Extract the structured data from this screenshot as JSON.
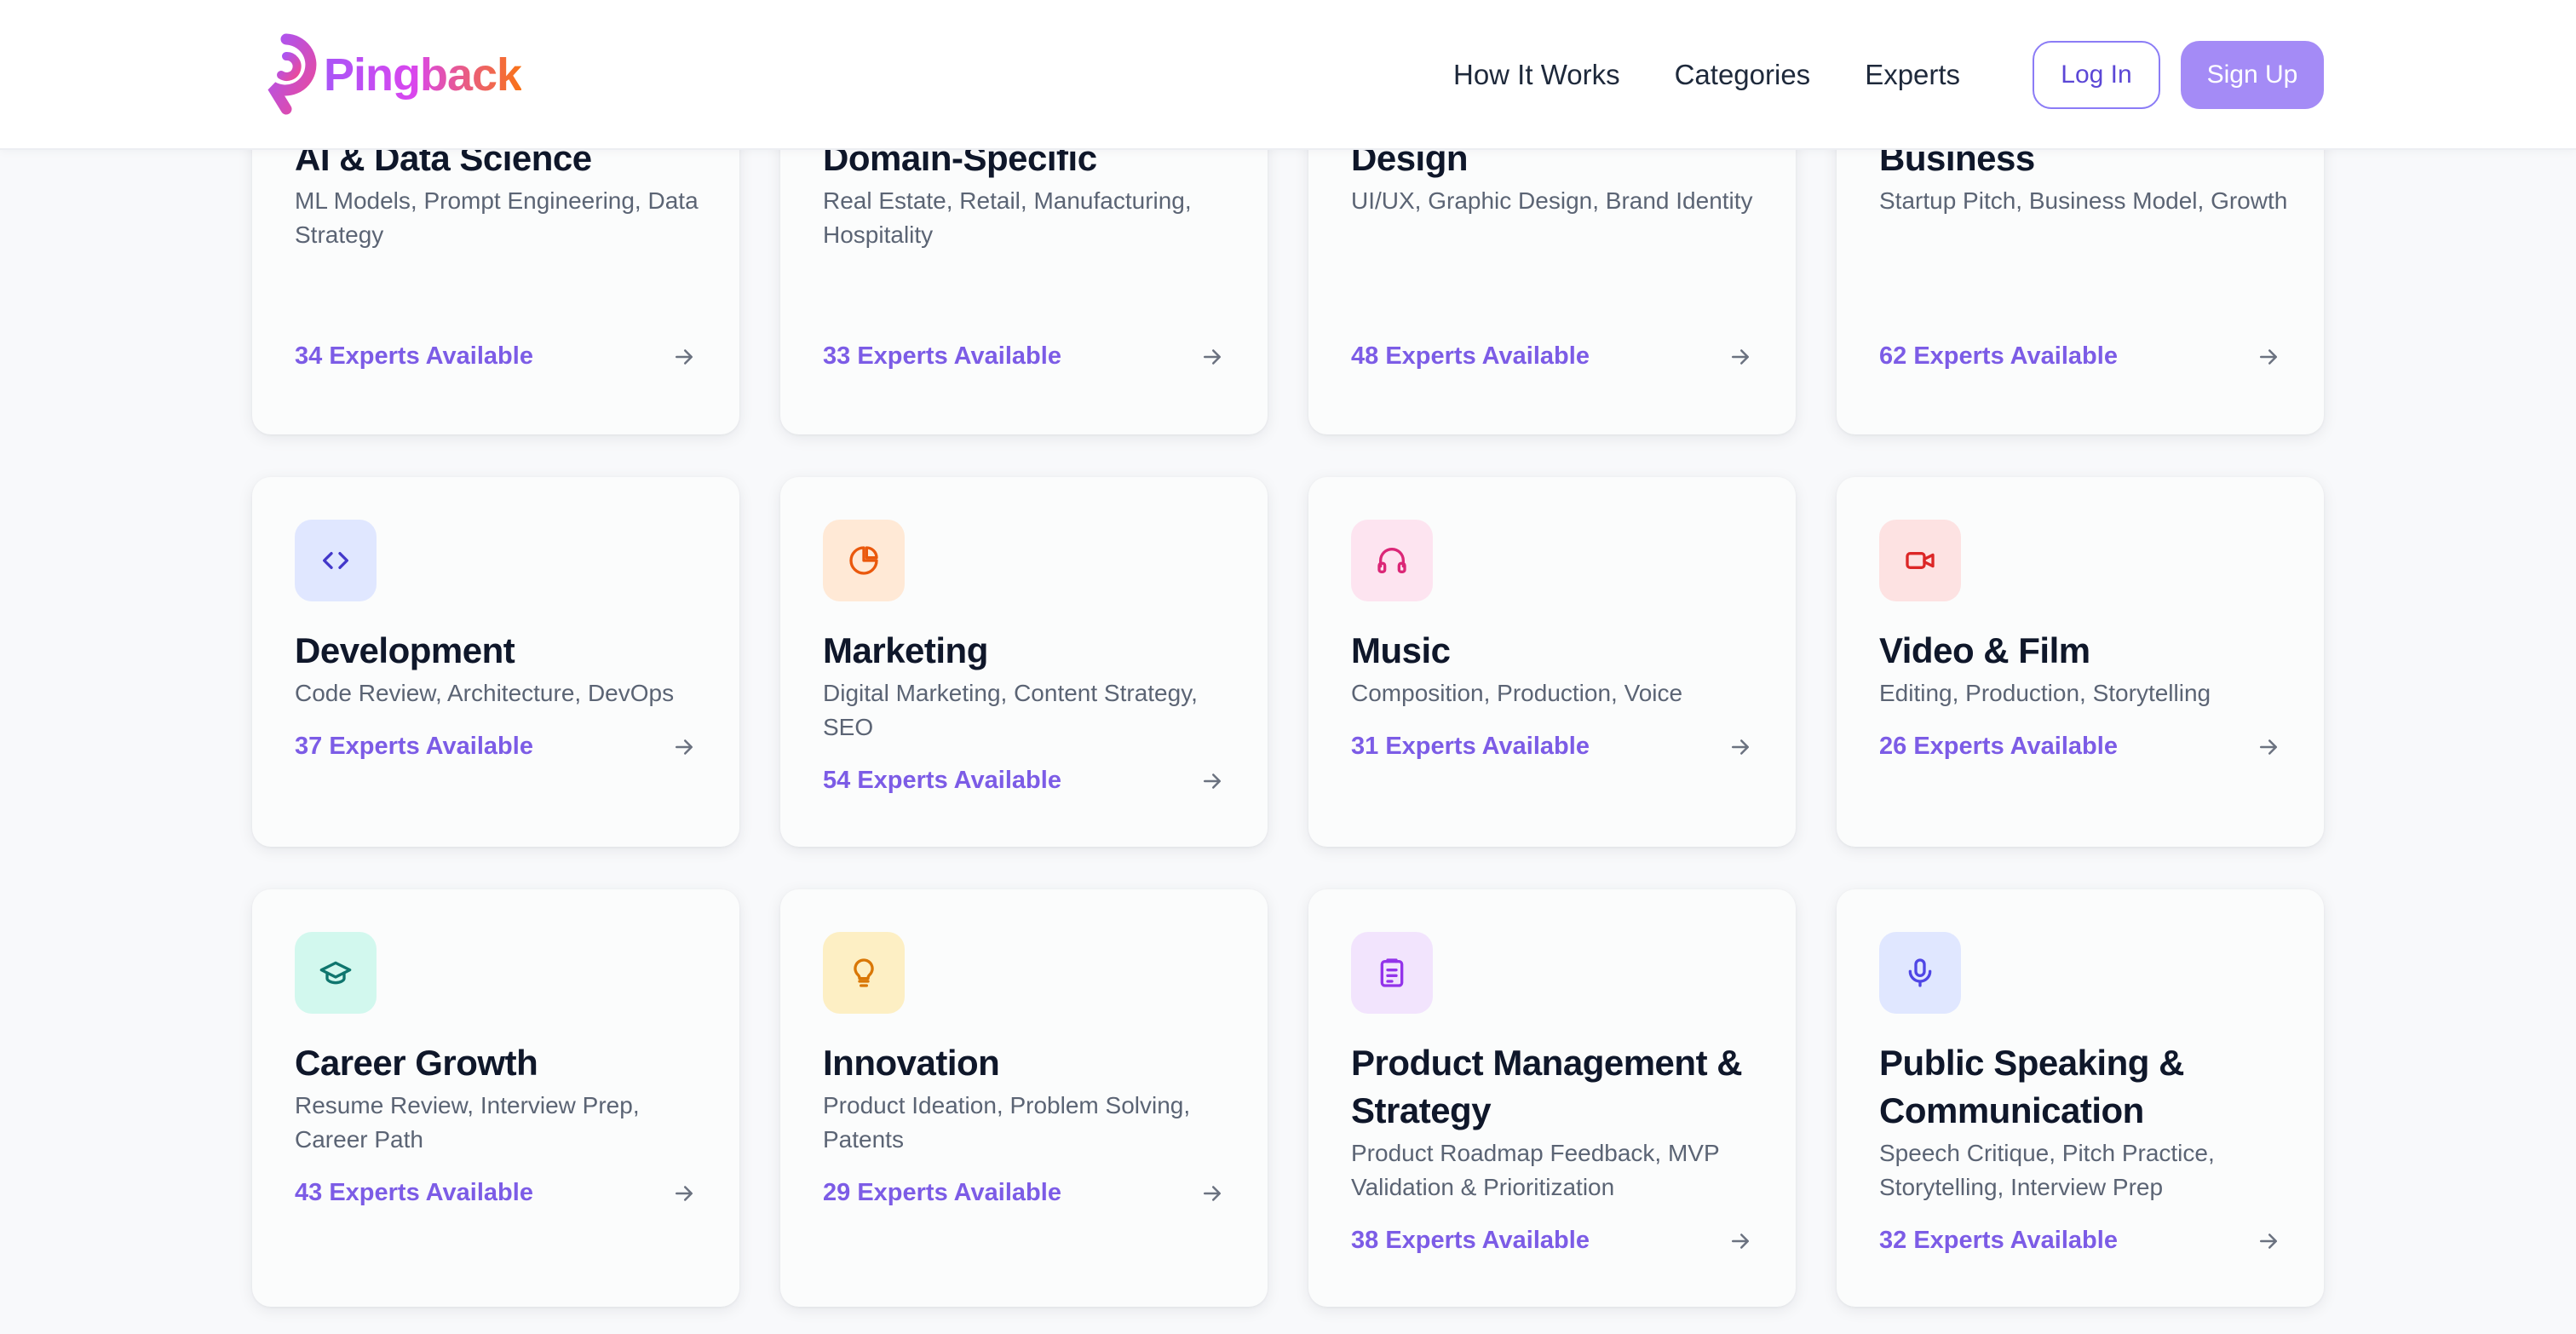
{
  "header": {
    "brand": "Pingback",
    "nav": [
      "How It Works",
      "Categories",
      "Experts"
    ],
    "login_label": "Log In",
    "signup_label": "Sign Up"
  },
  "categories": [
    {
      "title": "AI & Data Science",
      "desc": "ML Models, Prompt Engineering, Data Strategy",
      "experts": "34 Experts Available",
      "icon": "brain-icon",
      "color": "#2563eb"
    },
    {
      "title": "Domain-Specific",
      "desc": "Real Estate, Retail, Manufacturing, Hospitality",
      "experts": "33 Experts Available",
      "icon": "building-icon",
      "color": "#d97706"
    },
    {
      "title": "Design",
      "desc": "UI/UX, Graphic Design, Brand Identity",
      "experts": "48 Experts Available",
      "icon": "pen-icon",
      "color": "#2563eb"
    },
    {
      "title": "Business",
      "desc": "Startup Pitch, Business Model, Growth",
      "experts": "62 Experts Available",
      "icon": "briefcase-icon",
      "color": "#9333ea"
    },
    {
      "title": "Development",
      "desc": "Code Review, Architecture, DevOps",
      "experts": "37 Experts Available",
      "icon": "code-icon",
      "color": "#4338ca"
    },
    {
      "title": "Marketing",
      "desc": "Digital Marketing, Content Strategy, SEO",
      "experts": "54 Experts Available",
      "icon": "pie-chart-icon",
      "color": "#ea580c"
    },
    {
      "title": "Music",
      "desc": "Composition, Production, Voice",
      "experts": "31 Experts Available",
      "icon": "headphones-icon",
      "color": "#db2777"
    },
    {
      "title": "Video & Film",
      "desc": "Editing, Production, Storytelling",
      "experts": "26 Experts Available",
      "icon": "video-camera-icon",
      "color": "#dc2626"
    },
    {
      "title": "Career Growth",
      "desc": "Resume Review, Interview Prep, Career Path",
      "experts": "43 Experts Available",
      "icon": "graduation-cap-icon",
      "color": "#0f766e"
    },
    {
      "title": "Innovation",
      "desc": "Product Ideation, Problem Solving, Patents",
      "experts": "29 Experts Available",
      "icon": "lightbulb-icon",
      "color": "#d97706"
    },
    {
      "title": "Product Management & Strategy",
      "desc": "Product Roadmap Feedback, MVP Validation & Prioritization",
      "experts": "38 Experts Available",
      "icon": "clipboard-icon",
      "color": "#9333ea"
    },
    {
      "title": "Public Speaking & Communication",
      "desc": "Speech Critique, Pitch Practice, Storytelling, Interview Prep",
      "experts": "32 Experts Available",
      "icon": "microphone-icon",
      "color": "#4f46e5"
    }
  ]
}
